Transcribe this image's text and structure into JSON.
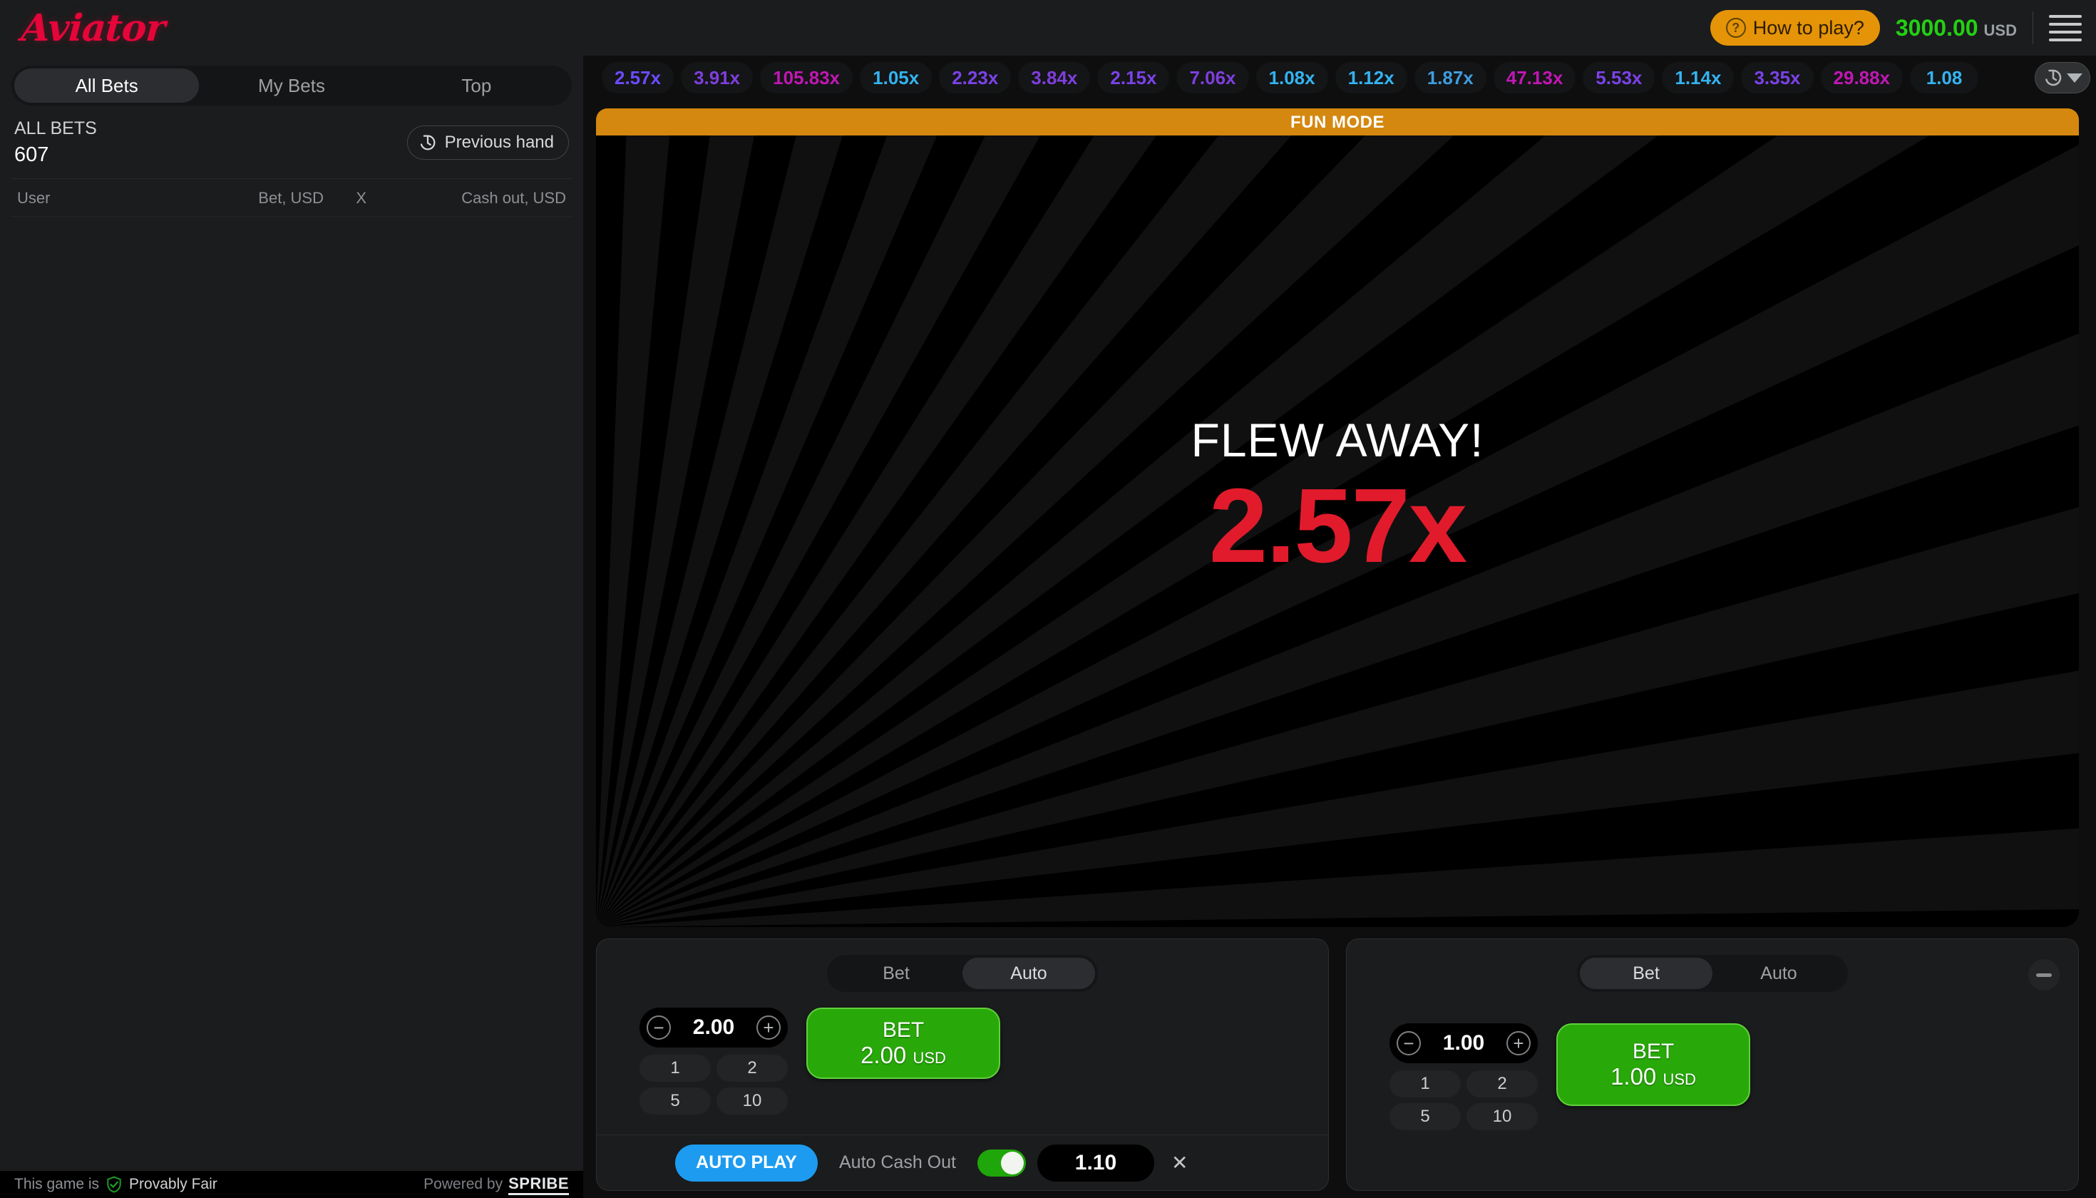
{
  "header": {
    "logo": "Aviator",
    "how_to_play": "How to play?",
    "balance_amount": "3000.00",
    "balance_currency": "USD",
    "icons": {
      "help": "question-circle-icon",
      "menu": "hamburger-menu-icon"
    }
  },
  "sidebar": {
    "tabs": [
      {
        "label": "All Bets",
        "active": true
      },
      {
        "label": "My Bets",
        "active": false
      },
      {
        "label": "Top",
        "active": false
      }
    ],
    "all_bets_title": "ALL BETS",
    "all_bets_count": "607",
    "previous_hand": "Previous hand",
    "columns": {
      "user": "User",
      "bet": "Bet, USD",
      "x": "X",
      "cashout": "Cash out, USD"
    },
    "rows": []
  },
  "footer": {
    "prefix": "This game is",
    "provably_fair": "Provably Fair",
    "powered_by": "Powered by",
    "provider": "SPRIBE"
  },
  "multiplier_history": {
    "items": [
      {
        "value": "2.57x",
        "color": "#6d4bff"
      },
      {
        "value": "3.91x",
        "color": "#7f3ede"
      },
      {
        "value": "105.83x",
        "color": "#c017b4"
      },
      {
        "value": "1.05x",
        "color": "#34b3f1"
      },
      {
        "value": "2.23x",
        "color": "#7b42e8"
      },
      {
        "value": "3.84x",
        "color": "#7f3ede"
      },
      {
        "value": "2.15x",
        "color": "#7b42e8"
      },
      {
        "value": "7.06x",
        "color": "#7f3ede"
      },
      {
        "value": "1.08x",
        "color": "#34b3f1"
      },
      {
        "value": "1.12x",
        "color": "#34b3f1"
      },
      {
        "value": "1.87x",
        "color": "#3f9de0"
      },
      {
        "value": "47.13x",
        "color": "#c017b4"
      },
      {
        "value": "5.53x",
        "color": "#7b42e8"
      },
      {
        "value": "1.14x",
        "color": "#34b3f1"
      },
      {
        "value": "3.35x",
        "color": "#7b42e8"
      },
      {
        "value": "29.88x",
        "color": "#c017b4"
      },
      {
        "value": "1.08",
        "color": "#34b3f1"
      }
    ],
    "history_button_icon": "history-clock-icon",
    "history_button_chevron": "chevron-down-icon"
  },
  "game": {
    "fun_mode_banner": "FUN MODE",
    "status": "FLEW AWAY!",
    "crash_multiplier": "2.57x",
    "crash_color": "#e11b2b"
  },
  "bet_panel_left": {
    "tabs": [
      {
        "label": "Bet",
        "active": false
      },
      {
        "label": "Auto",
        "active": true
      }
    ],
    "amount": "2.00",
    "minus_icon": "minus-circle-icon",
    "plus_icon": "plus-circle-icon",
    "quick_amounts": [
      "1",
      "2",
      "5",
      "10"
    ],
    "bet_button_label": "BET",
    "bet_button_amount": "2.00",
    "bet_button_currency": "USD",
    "auto_play_label": "AUTO PLAY",
    "auto_cash_out_label": "Auto Cash Out",
    "auto_cash_out_enabled": true,
    "auto_cash_out_value": "1.10",
    "clear_icon": "close-icon"
  },
  "bet_panel_right": {
    "tabs": [
      {
        "label": "Bet",
        "active": true
      },
      {
        "label": "Auto",
        "active": false
      }
    ],
    "amount": "1.00",
    "minus_icon": "minus-circle-icon",
    "plus_icon": "plus-circle-icon",
    "quick_amounts": [
      "1",
      "2",
      "5",
      "10"
    ],
    "bet_button_label": "BET",
    "bet_button_amount": "1.00",
    "bet_button_currency": "USD",
    "collapse_icon": "minus-icon"
  }
}
